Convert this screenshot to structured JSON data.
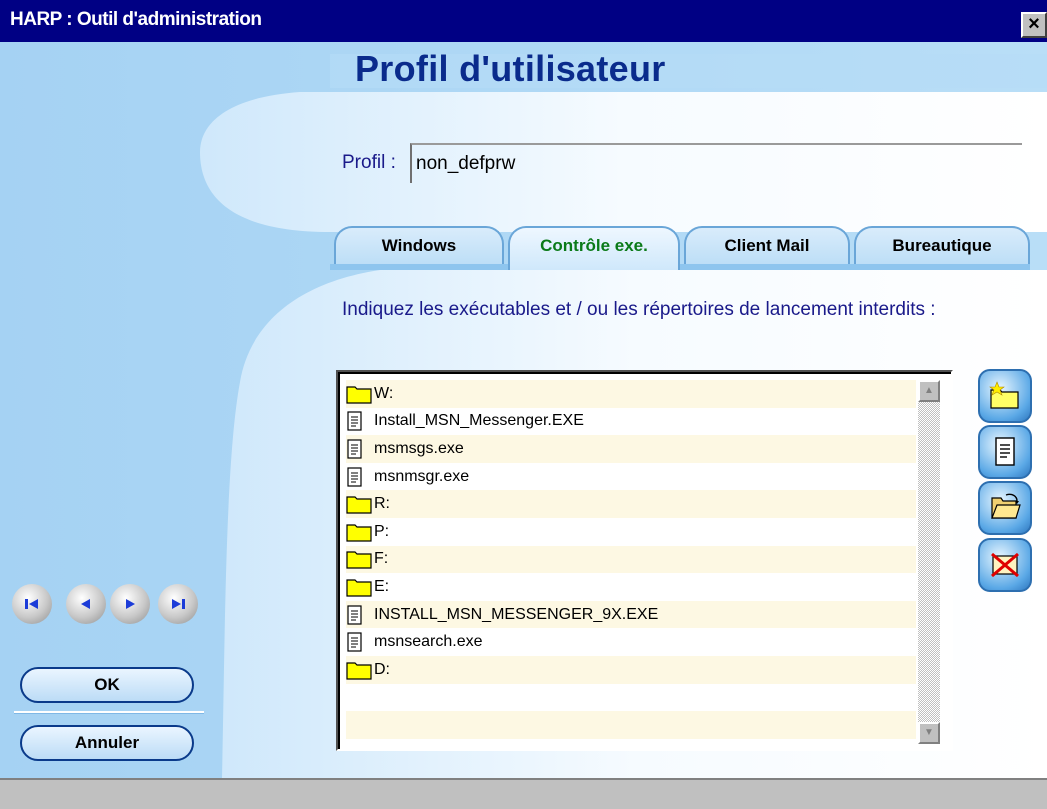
{
  "window": {
    "title": "HARP : Outil d'administration",
    "close_label": "×"
  },
  "heading": "Profil d'utilisateur",
  "profile": {
    "label": "Profil :",
    "value": "non_defprw"
  },
  "tabs": [
    {
      "label": "Windows",
      "active": false
    },
    {
      "label": "Contrôle exe.",
      "active": true
    },
    {
      "label": "Client Mail",
      "active": false
    },
    {
      "label": "Bureautique",
      "active": false
    }
  ],
  "instructions": "Indiquez les exécutables et / ou les répertoires de lancement interdits :",
  "entries": [
    {
      "icon": "folder-icon",
      "text": "W:"
    },
    {
      "icon": "file-icon",
      "text": "Install_MSN_Messenger.EXE"
    },
    {
      "icon": "file-icon",
      "text": "msmsgs.exe"
    },
    {
      "icon": "file-icon",
      "text": "msnmsgr.exe"
    },
    {
      "icon": "folder-icon",
      "text": "R:"
    },
    {
      "icon": "folder-icon",
      "text": "P:"
    },
    {
      "icon": "folder-icon",
      "text": "F:"
    },
    {
      "icon": "folder-icon",
      "text": "E:"
    },
    {
      "icon": "file-icon",
      "text": "INSTALL_MSN_MESSENGER_9X.EXE"
    },
    {
      "icon": "file-icon",
      "text": "msnsearch.exe"
    },
    {
      "icon": "folder-icon",
      "text": "D:"
    }
  ],
  "side_buttons": [
    "new-folder-icon",
    "new-file-icon",
    "open-folder-icon",
    "delete-icon"
  ],
  "nav_buttons": [
    "first-record-icon",
    "previous-record-icon",
    "next-record-icon",
    "last-record-icon"
  ],
  "buttons": {
    "ok": "OK",
    "cancel": "Annuler"
  },
  "colors": {
    "title_bar": "#000084",
    "background": "#a8d4f4",
    "heading": "#0a2b8c",
    "active_tab_text": "#0a7a18"
  }
}
